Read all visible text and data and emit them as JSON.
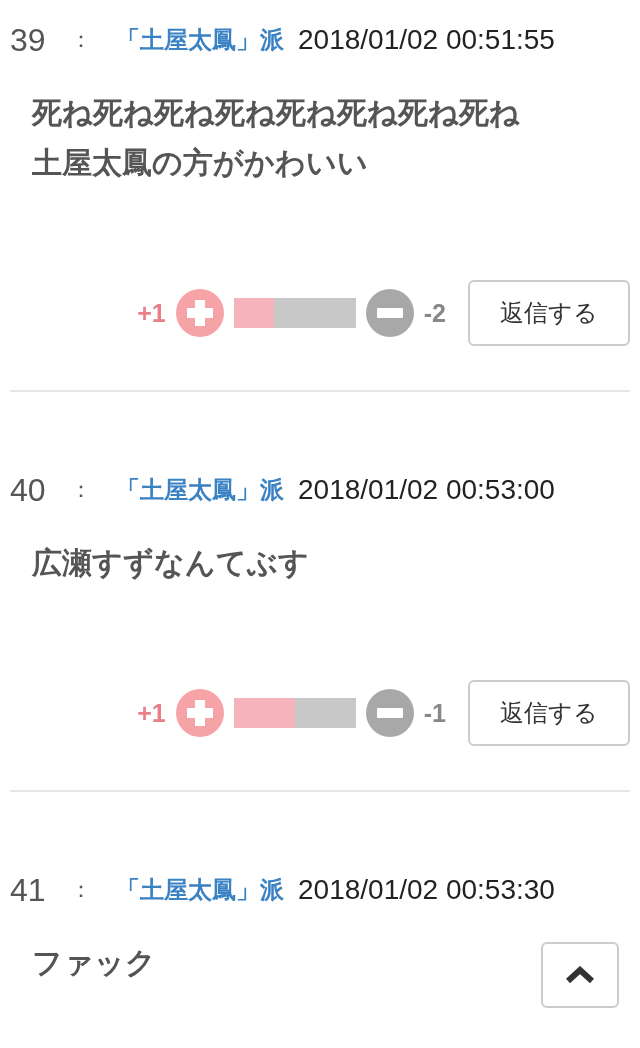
{
  "comments": [
    {
      "number": "39",
      "separator": "：",
      "author": "「土屋太鳳」派",
      "date": "2018/01/02 00:51:55",
      "body": [
        "死ね死ね死ね死ね死ね死ね死ね死ね",
        "土屋太鳳の方がかわいい"
      ],
      "vote": {
        "plus": "+1",
        "level": 0.33,
        "minus": "-2",
        "reply": "返信する"
      }
    },
    {
      "number": "40",
      "separator": "：",
      "author": "「土屋太鳳」派",
      "date": "2018/01/02 00:53:00",
      "body": [
        "広瀬すずなんてぶす"
      ],
      "vote": {
        "plus": "+1",
        "level": 0.5,
        "minus": "-1",
        "reply": "返信する"
      }
    },
    {
      "number": "41",
      "separator": "：",
      "author": "「土屋太鳳」派",
      "date": "2018/01/02 00:53:30",
      "body": [
        "ファック"
      ]
    }
  ]
}
